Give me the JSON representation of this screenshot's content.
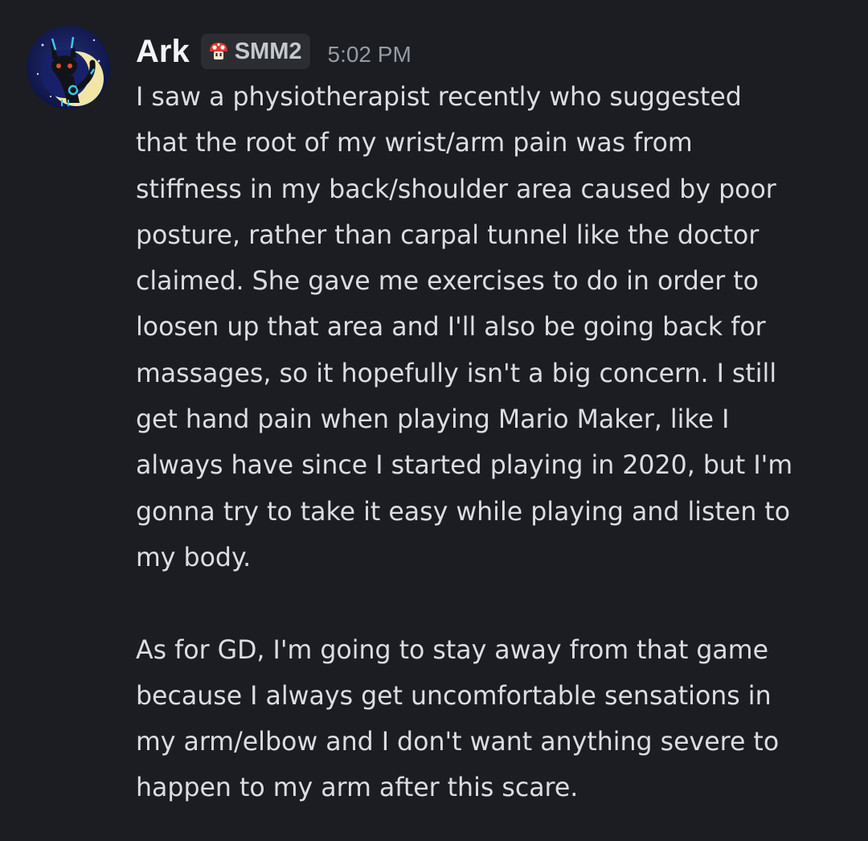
{
  "message": {
    "author": "Ark",
    "role_tag": {
      "icon": "mushroom-icon",
      "label": "SMM2"
    },
    "timestamp": "5:02 PM",
    "avatar": "umbreon-avatar",
    "lines_paragraph_1": [
      "I saw a physiotherapist recently who suggested",
      "that the root of my wrist/arm pain was from",
      "stiffness in my back/shoulder area caused by poor",
      "posture, rather than carpal tunnel like the doctor",
      "claimed. She gave me exercises to do in order to",
      "loosen up that area and I'll also be going back for",
      "massages, so it hopefully isn't a big concern. I still",
      "get hand pain when playing Mario Maker, like I",
      "always have since I started playing in 2020, but I'm",
      "gonna try to take it easy while playing and listen to",
      "my body."
    ],
    "lines_paragraph_2": [
      "As for GD, I'm going to stay away from that game",
      "because I always get uncomfortable sensations in",
      "my arm/elbow and I don't want anything severe to",
      "happen to my arm after this scare."
    ]
  },
  "colors": {
    "background": "#1c1d22",
    "author": "#f2f3f5",
    "body_text": "#dbdee1",
    "timestamp": "#949ba4",
    "tag_background": "#2b2d33",
    "umbreon_ring": "#38c8f0"
  }
}
